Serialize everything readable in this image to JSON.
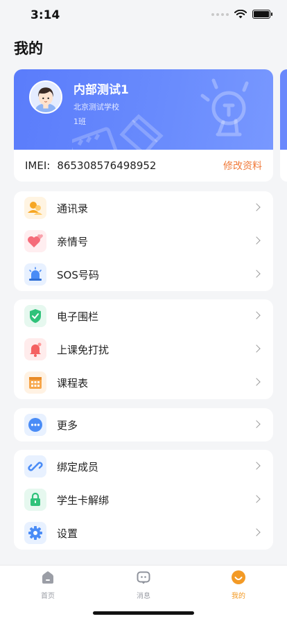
{
  "status_bar": {
    "time": "3:14"
  },
  "page": {
    "title": "我的"
  },
  "profile": {
    "name": "内部测试1",
    "school": "北京测试学校",
    "class": "1班",
    "imei_label": "IMEI:",
    "imei_value": "865308576498952",
    "edit_label": "修改资料"
  },
  "groups": [
    {
      "items": [
        {
          "label": "通讯录",
          "icon": "contacts-icon"
        },
        {
          "label": "亲情号",
          "icon": "family-number-icon"
        },
        {
          "label": "SOS号码",
          "icon": "sos-alarm-icon"
        }
      ]
    },
    {
      "items": [
        {
          "label": "电子围栏",
          "icon": "geofence-shield-icon"
        },
        {
          "label": "上课免打扰",
          "icon": "do-not-disturb-bell-icon"
        },
        {
          "label": "课程表",
          "icon": "schedule-calendar-icon"
        }
      ]
    },
    {
      "items": [
        {
          "label": "更多",
          "icon": "more-dots-icon"
        }
      ]
    },
    {
      "items": [
        {
          "label": "绑定成员",
          "icon": "bind-link-icon"
        },
        {
          "label": "学生卡解绑",
          "icon": "unbind-lock-icon"
        },
        {
          "label": "设置",
          "icon": "settings-gear-icon"
        }
      ]
    }
  ],
  "tabbar": {
    "tabs": [
      {
        "label": "首页",
        "icon": "home-icon"
      },
      {
        "label": "消息",
        "icon": "message-icon"
      },
      {
        "label": "我的",
        "icon": "profile-smile-icon",
        "active": true
      }
    ]
  },
  "colors": {
    "accent": "#f39a25",
    "brand_blue": "#5a7cfb",
    "edit_orange": "#f07a3a"
  }
}
